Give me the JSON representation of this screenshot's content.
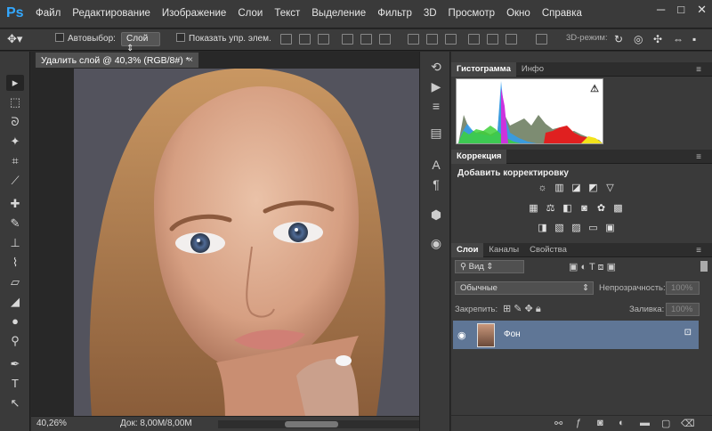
{
  "menubar": {
    "logo": "Ps",
    "items": [
      "Файл",
      "Редактирование",
      "Изображение",
      "Слои",
      "Текст",
      "Выделение",
      "Фильтр",
      "3D",
      "Просмотр",
      "Окно",
      "Справка"
    ],
    "window_controls": [
      "─",
      "□",
      "✕"
    ]
  },
  "options": {
    "autoselect_label": "Автовыбор:",
    "autoselect_value": "Слой",
    "show_controls_label": "Показать упр. элем.",
    "mode_3d_label": "3D-режим:"
  },
  "document": {
    "tab_title": "Удалить слой @ 40,3% (RGB/8#) *",
    "close": "×",
    "zoom": "40,26%",
    "doc_info": "Док: 8,00M/8,00M"
  },
  "panels": {
    "hist_tabs": [
      "Гистограмма",
      "Инфо"
    ],
    "corr_tab": "Коррекция",
    "corr_title": "Добавить корректировку",
    "layers_tabs": [
      "Слои",
      "Каналы",
      "Свойства"
    ],
    "kind_search": "Вид",
    "blend_mode": "Обычные",
    "opacity_label": "Непрозрачность:",
    "opacity_value": "100%",
    "lock_label": "Закрепить:",
    "fill_label": "Заливка:",
    "fill_value": "100%",
    "layer_name": "Фон"
  },
  "colors": {
    "accent": "#33a8ff",
    "selected_layer": "#5f7696"
  },
  "icons": [
    "move-icon",
    "marquee-icon",
    "lasso-icon",
    "magic-wand-icon",
    "crop-icon",
    "eyedropper-icon",
    "healing-icon",
    "brush-icon",
    "stamp-icon",
    "history-brush-icon",
    "eraser-icon",
    "bucket-icon",
    "blur-icon",
    "dodge-icon",
    "pen-icon",
    "type-icon",
    "path-select-icon"
  ]
}
